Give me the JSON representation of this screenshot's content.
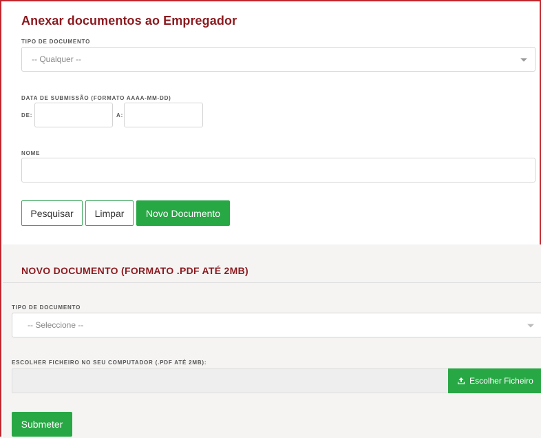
{
  "page_title": "Anexar documentos ao Empregador",
  "filter": {
    "doc_type_label": "TIPO DE DOCUMENTO",
    "doc_type_value": "-- Qualquer --",
    "date_label": "DATA DE SUBMISSÃO (FORMATO AAAA-MM-DD)",
    "from_label": "DE:",
    "to_label": "A:",
    "from_value": "",
    "to_value": "",
    "name_label": "NOME",
    "name_value": ""
  },
  "actions": {
    "search_label": "Pesquisar",
    "clear_label": "Limpar",
    "new_doc_label": "Novo Documento"
  },
  "new_document": {
    "title": "NOVO DOCUMENTO (FORMATO .PDF ATÉ 2MB)",
    "doc_type_label": "TIPO DE DOCUMENTO",
    "doc_type_value": "-- Seleccione --",
    "file_label": "ESCOLHER FICHEIRO NO SEU COMPUTADOR (.PDF ATÉ 2MB):",
    "file_value": "",
    "choose_file_label": "Escolher Ficheiro",
    "choose_file_icon": "upload-icon",
    "submit_label": "Submeter"
  },
  "colors": {
    "title_red": "#8b1a1f",
    "frame_red": "#c0262d",
    "green": "#28a745",
    "panel_gray": "#f5f4f3"
  }
}
